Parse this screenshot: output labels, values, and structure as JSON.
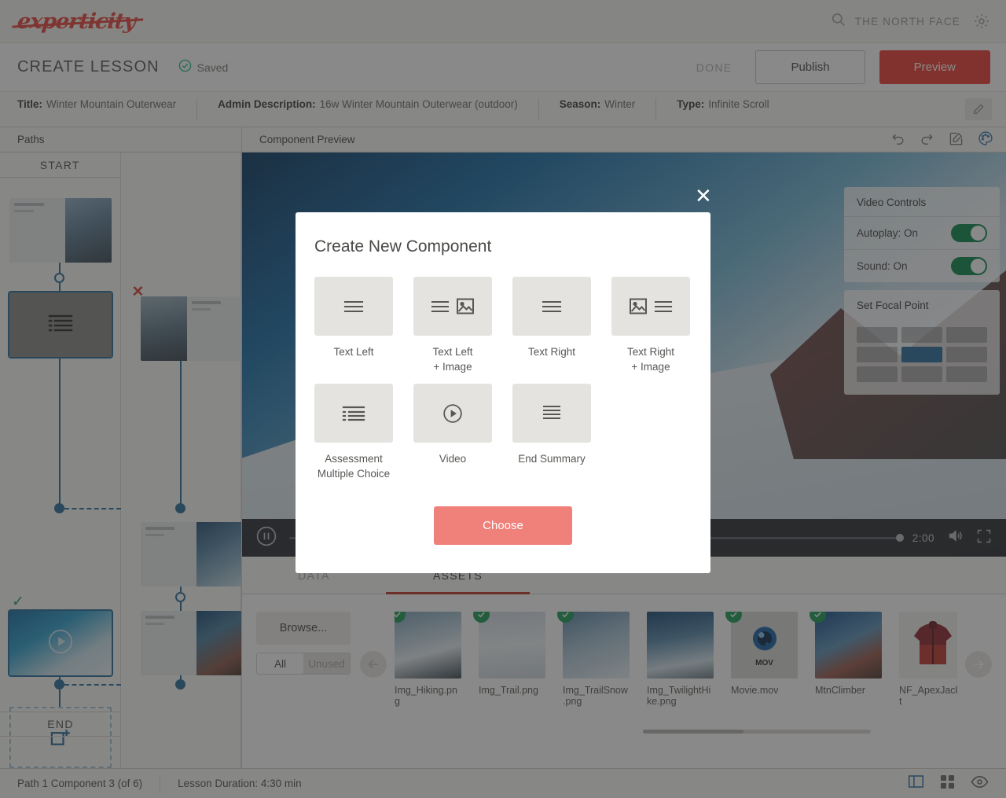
{
  "brand": {
    "logo_text": "experticity",
    "search_placeholder": "THE NORTH FACE",
    "search_icon": "search-icon",
    "settings_icon": "gear-icon"
  },
  "action_bar": {
    "page_title": "CREATE LESSON",
    "saved_label": "Saved",
    "saved_icon": "check-circle-icon",
    "done_label": "DONE",
    "publish_label": "Publish",
    "preview_label": "Preview",
    "preview_color": "#ef3f36"
  },
  "meta": {
    "items": [
      {
        "key": "Title:",
        "value": "Winter Mountain Outerwear"
      },
      {
        "key": "Admin Description:",
        "value": "16w Winter Mountain Outerwear (outdoor)"
      },
      {
        "key": "Season:",
        "value": "Winter"
      },
      {
        "key": "Type:",
        "value": "Infinite Scroll"
      }
    ],
    "edit_icon": "pencil-icon"
  },
  "paths": {
    "header": "Paths",
    "start_label": "START",
    "end_label": "END"
  },
  "preview": {
    "header": "Component Preview",
    "tools": [
      "undo-icon",
      "redo-icon",
      "edit-square-icon",
      "palette-icon"
    ],
    "video": {
      "pause_icon": "pause-icon",
      "time": "2:00",
      "volume_icon": "volume-icon",
      "fullscreen_icon": "fullscreen-icon"
    }
  },
  "video_controls": {
    "title": "Video Controls",
    "rows": [
      {
        "label": "Autoplay: On",
        "on": true
      },
      {
        "label": "Sound: On",
        "on": true
      }
    ]
  },
  "focal_point": {
    "title": "Set Focal Point",
    "active_index": 4,
    "active_color": "#2a6f9e"
  },
  "tabs": [
    {
      "label": "DATA",
      "active": false
    },
    {
      "label": "ASSETS",
      "active": true
    }
  ],
  "assets_panel": {
    "browse_label": "Browse...",
    "filters": [
      {
        "label": "All",
        "active": true
      },
      {
        "label": "Unused",
        "active": false
      }
    ],
    "prev_icon": "arrow-left-icon",
    "next_icon": "arrow-right-icon",
    "items": [
      {
        "name": "Img_Hiking.png",
        "selected": true,
        "kind": "image"
      },
      {
        "name": "Img_Trail.png",
        "selected": true,
        "kind": "image"
      },
      {
        "name": "Img_TrailSnow.png",
        "selected": true,
        "kind": "image"
      },
      {
        "name": "Img_TwilightHike.png",
        "selected": false,
        "kind": "image"
      },
      {
        "name": "Movie.mov",
        "selected": true,
        "kind": "video",
        "badge": "MOV"
      },
      {
        "name": "MtnClimber",
        "selected": true,
        "kind": "image"
      },
      {
        "name": "NF_ApexJacket",
        "selected": false,
        "kind": "image"
      }
    ]
  },
  "status_bar": {
    "component_info": "Path 1 Component 3 (of 6)",
    "lesson_duration": "Lesson Duration: 4:30 min",
    "icons": [
      "panel-layout-icon",
      "grid-view-icon",
      "eye-icon"
    ]
  },
  "modal": {
    "title": "Create New Component",
    "close_icon": "close-icon",
    "choose_label": "Choose",
    "choose_color": "#f0807a",
    "components": [
      {
        "label": "Text Left",
        "label2": "",
        "icon": "text-left-icon"
      },
      {
        "label": "Text Left",
        "label2": "+ Image",
        "icon": "text-left-image-icon"
      },
      {
        "label": "Text Right",
        "label2": "",
        "icon": "text-right-icon"
      },
      {
        "label": "Text Right",
        "label2": "+ Image",
        "icon": "text-right-image-icon"
      },
      {
        "label": "Assessment",
        "label2": "Multiple Choice",
        "icon": "list-bullet-icon"
      },
      {
        "label": "Video",
        "label2": "",
        "icon": "play-circle-icon"
      },
      {
        "label": "End Summary",
        "label2": "",
        "icon": "text-lines-icon"
      }
    ]
  }
}
